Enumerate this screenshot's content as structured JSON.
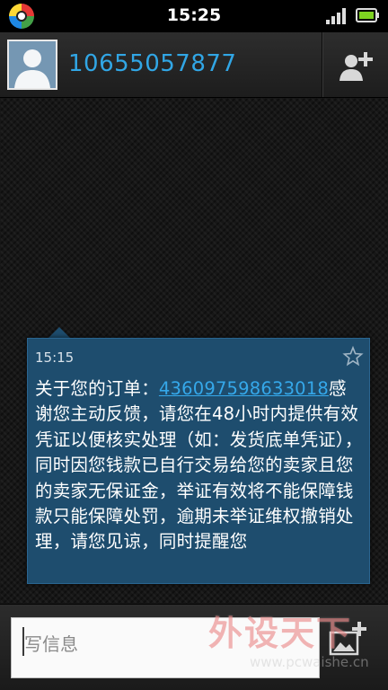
{
  "status_bar": {
    "time": "15:25",
    "logo_icon": "app-logo-icon",
    "signal_icon": "signal-strength-icon",
    "battery_icon": "battery-icon"
  },
  "conversation": {
    "contact_number": "10655057877",
    "avatar_icon": "person-silhouette-icon",
    "add_contact_icon": "add-contact-icon"
  },
  "message": {
    "time": "15:15",
    "text_prefix": "关于您的订单：",
    "order_number": "436097598633018",
    "text_body": "感谢您主动反馈，请您在48小时内提供有效凭证以便核实处理（如：发货底单凭证），同时因您钱款已自行交易给您的卖家且您的卖家无保证金，举证有效将不能保障钱款只能保障处罚，逾期未举证维权撤销处理，请您见谅，同时提醒您",
    "star_icon": "star-icon"
  },
  "compose": {
    "placeholder": "写信息",
    "attach_icon": "attach-image-icon"
  },
  "watermark": {
    "text": "外设天下",
    "url": "www.pcwaishe.cn"
  },
  "colors": {
    "accent": "#31a6e5",
    "bubble": "#1e4d6e",
    "link": "#35a8ea"
  }
}
